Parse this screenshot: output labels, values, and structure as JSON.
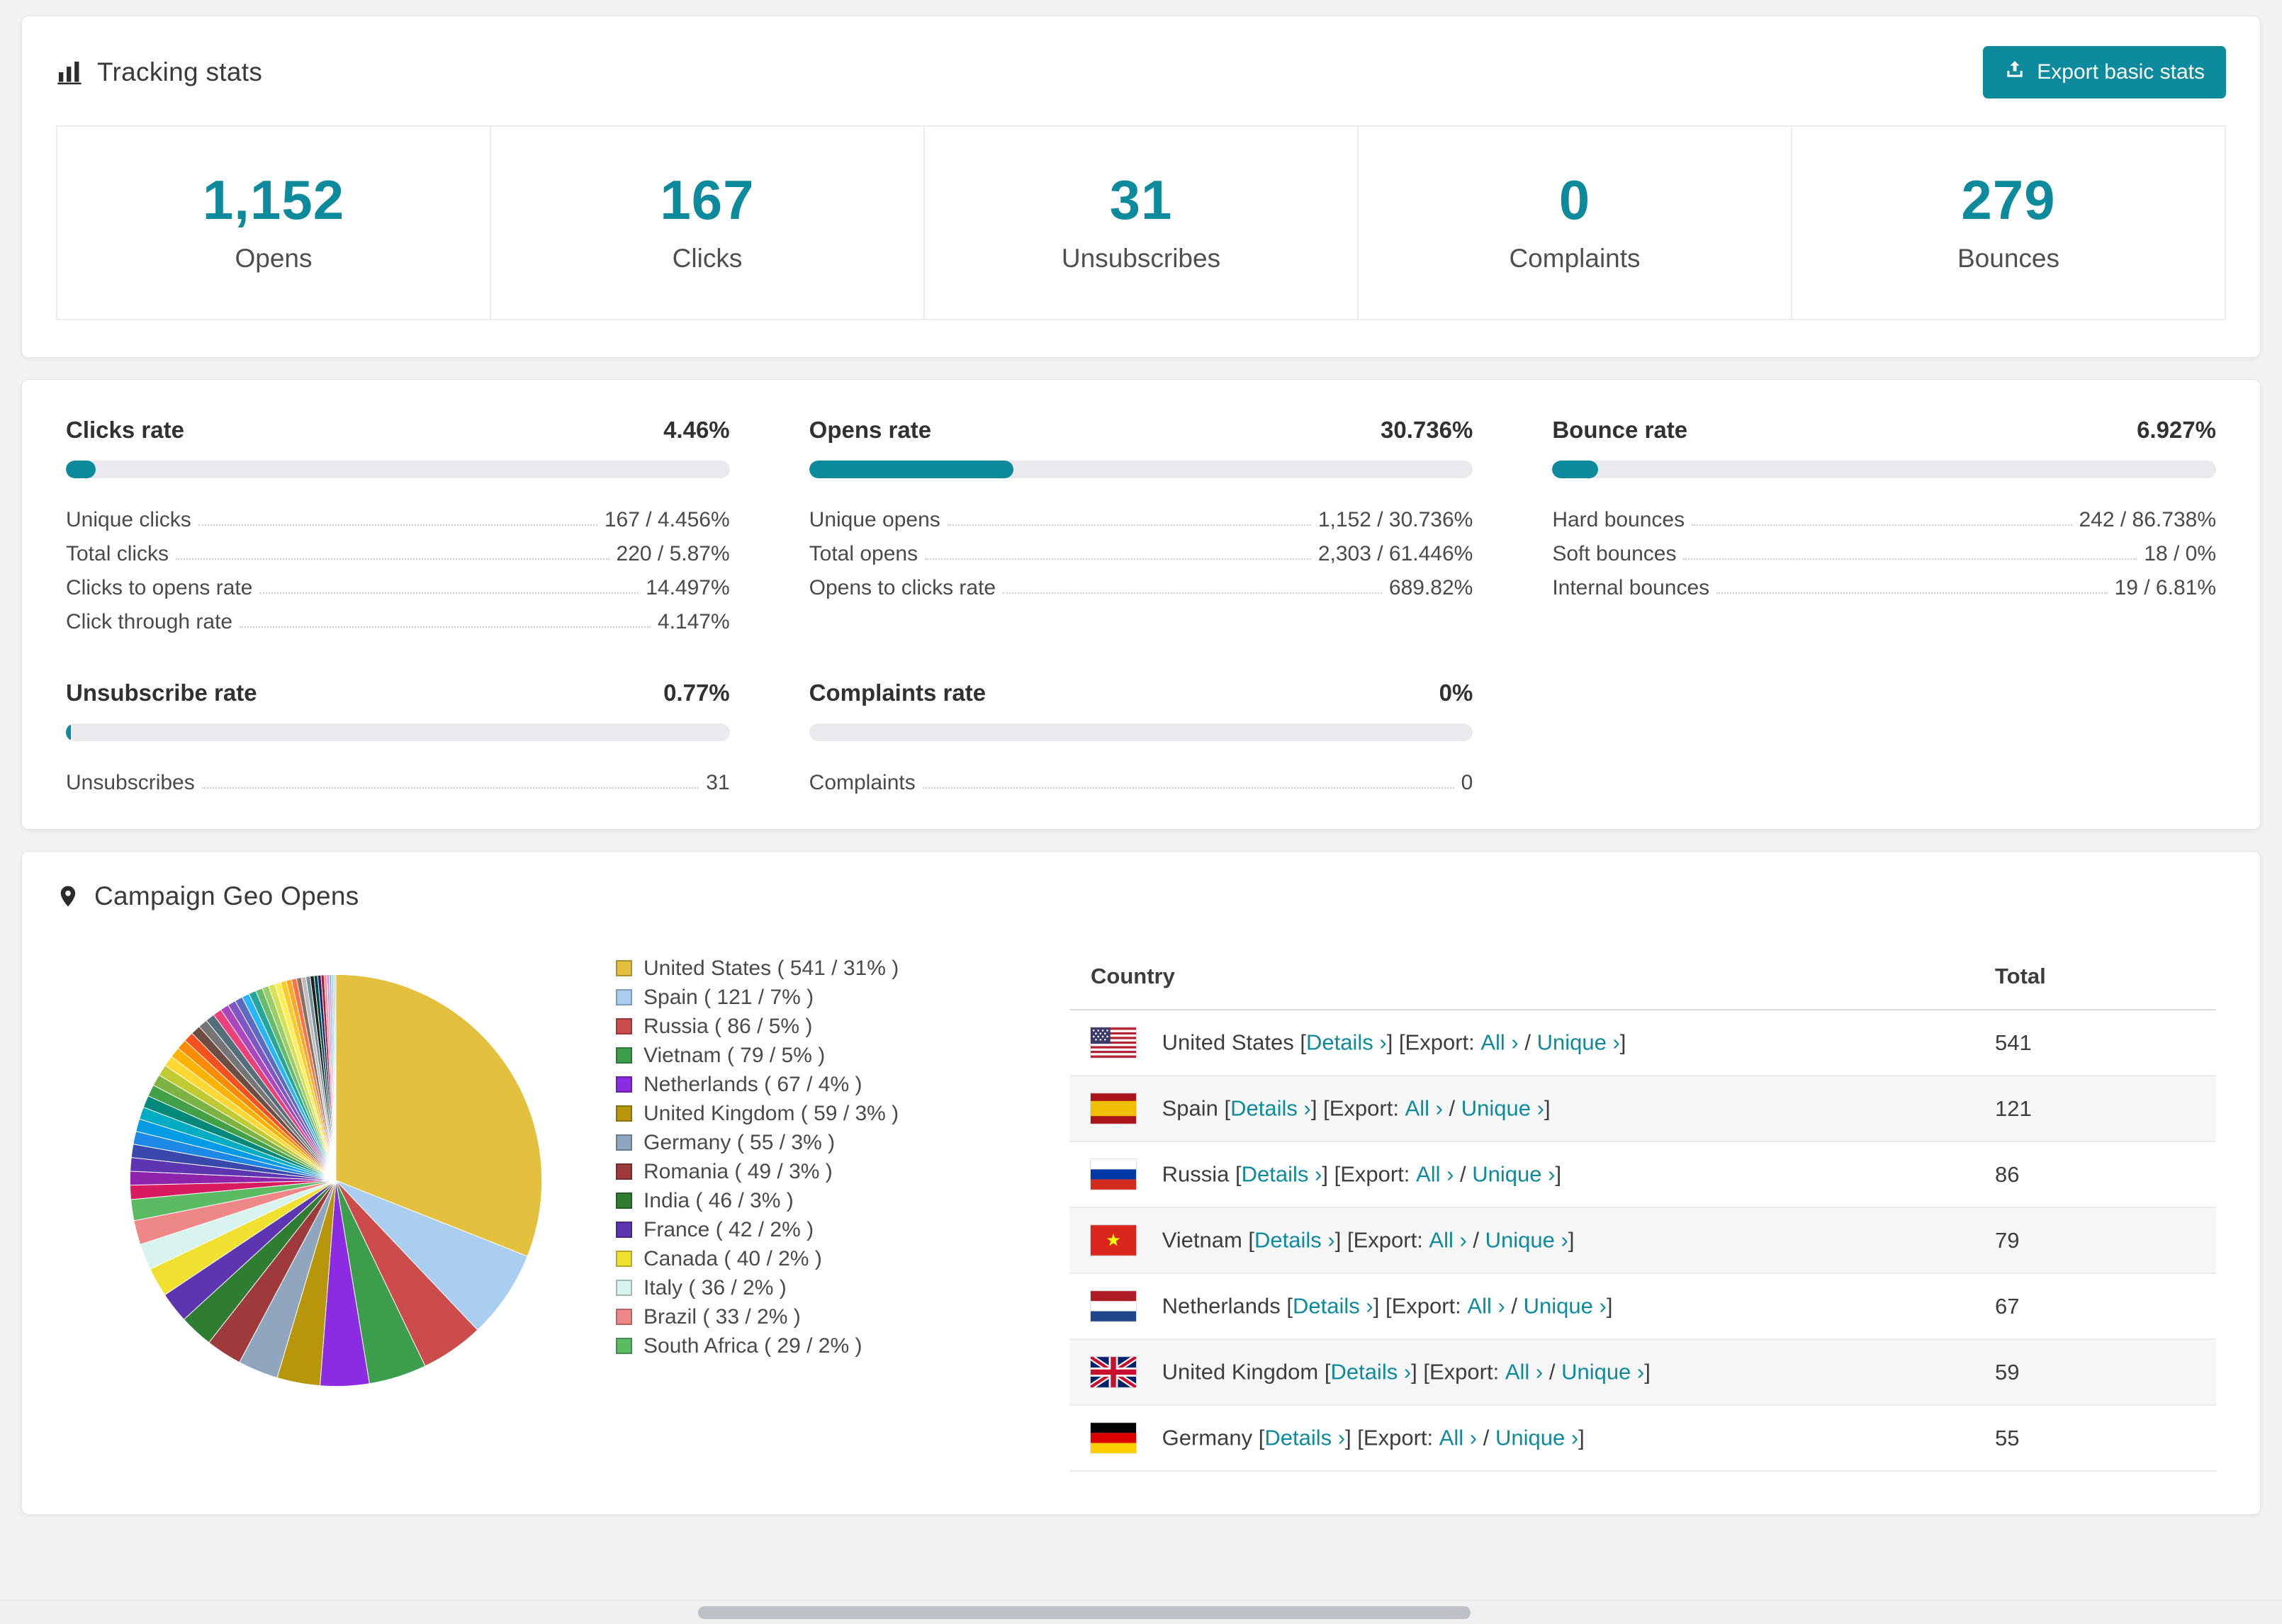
{
  "colors": {
    "accent": "#0E8A9D",
    "page_bg": "#F2F2F3",
    "link": "#0E8A9D"
  },
  "tracking": {
    "title": "Tracking stats",
    "export_button": "Export basic stats",
    "stats": [
      {
        "value": "1,152",
        "label": "Opens"
      },
      {
        "value": "167",
        "label": "Clicks"
      },
      {
        "value": "31",
        "label": "Unsubscribes"
      },
      {
        "value": "0",
        "label": "Complaints"
      },
      {
        "value": "279",
        "label": "Bounces"
      }
    ]
  },
  "rates": [
    {
      "title": "Clicks rate",
      "value": "4.46%",
      "percent": 4.46,
      "rows": [
        {
          "label": "Unique clicks",
          "value": "167 / 4.456%"
        },
        {
          "label": "Total clicks",
          "value": "220 / 5.87%"
        },
        {
          "label": "Clicks to opens rate",
          "value": "14.497%"
        },
        {
          "label": "Click through rate",
          "value": "4.147%"
        }
      ]
    },
    {
      "title": "Opens rate",
      "value": "30.736%",
      "percent": 30.736,
      "rows": [
        {
          "label": "Unique opens",
          "value": "1,152 / 30.736%"
        },
        {
          "label": "Total opens",
          "value": "2,303 / 61.446%"
        },
        {
          "label": "Opens to clicks rate",
          "value": "689.82%"
        }
      ]
    },
    {
      "title": "Bounce rate",
      "value": "6.927%",
      "percent": 6.927,
      "rows": [
        {
          "label": "Hard bounces",
          "value": "242 / 86.738%"
        },
        {
          "label": "Soft bounces",
          "value": "18 / 0%"
        },
        {
          "label": "Internal bounces",
          "value": "19 / 6.81%"
        }
      ]
    },
    {
      "title": "Unsubscribe rate",
      "value": "0.77%",
      "percent": 0.77,
      "rows": [
        {
          "label": "Unsubscribes",
          "value": "31"
        }
      ]
    },
    {
      "title": "Complaints rate",
      "value": "0%",
      "percent": 0,
      "rows": [
        {
          "label": "Complaints",
          "value": "0"
        }
      ]
    }
  ],
  "geo": {
    "title": "Campaign Geo Opens",
    "table_headers": {
      "country": "Country",
      "total": "Total"
    },
    "link_labels": {
      "details": "Details ›",
      "export": "Export:",
      "all": "All ›",
      "unique": "Unique ›"
    },
    "visible_table_rows": 7,
    "countries": [
      {
        "name": "United States",
        "flag": "us",
        "total": 541,
        "percent": 31,
        "color": "#E4C03F"
      },
      {
        "name": "Spain",
        "flag": "es",
        "total": 121,
        "percent": 7,
        "color": "#A9CEF0"
      },
      {
        "name": "Russia",
        "flag": "ru",
        "total": 86,
        "percent": 5,
        "color": "#CC4B4B"
      },
      {
        "name": "Vietnam",
        "flag": "vn",
        "total": 79,
        "percent": 5,
        "color": "#3C9E4D"
      },
      {
        "name": "Netherlands",
        "flag": "nl",
        "total": 67,
        "percent": 4,
        "color": "#8B2BE2"
      },
      {
        "name": "United Kingdom",
        "flag": "gb",
        "total": 59,
        "percent": 3,
        "color": "#B8960C"
      },
      {
        "name": "Germany",
        "flag": "de",
        "total": 55,
        "percent": 3,
        "color": "#8FA6BE"
      },
      {
        "name": "Romania",
        "flag": "ro",
        "total": 49,
        "percent": 3,
        "color": "#9E3A3C"
      },
      {
        "name": "India",
        "flag": "in",
        "total": 46,
        "percent": 3,
        "color": "#2F7D33"
      },
      {
        "name": "France",
        "flag": "fr",
        "total": 42,
        "percent": 2,
        "color": "#5D35B0"
      },
      {
        "name": "Canada",
        "flag": "ca",
        "total": 40,
        "percent": 2,
        "color": "#F0E130"
      },
      {
        "name": "Italy",
        "flag": "it",
        "total": 36,
        "percent": 2,
        "color": "#D8F3EE"
      },
      {
        "name": "Brazil",
        "flag": "br",
        "total": 33,
        "percent": 2,
        "color": "#EE8787"
      },
      {
        "name": "South Africa",
        "flag": "za",
        "total": 29,
        "percent": 2,
        "color": "#5BBB63"
      }
    ],
    "chart_data": {
      "type": "pie",
      "title": "Campaign Geo Opens",
      "labels": [
        "United States",
        "Spain",
        "Russia",
        "Vietnam",
        "Netherlands",
        "United Kingdom",
        "Germany",
        "Romania",
        "India",
        "France",
        "Canada",
        "Italy",
        "Brazil",
        "South Africa"
      ],
      "values": [
        541,
        121,
        86,
        79,
        67,
        59,
        55,
        49,
        46,
        42,
        40,
        36,
        33,
        29
      ],
      "colors": [
        "#E4C03F",
        "#A9CEF0",
        "#CC4B4B",
        "#3C9E4D",
        "#8B2BE2",
        "#B8960C",
        "#8FA6BE",
        "#9E3A3C",
        "#2F7D33",
        "#5D35B0",
        "#F0E130",
        "#D8F3EE",
        "#EE8787",
        "#5BBB63"
      ],
      "others_value": 462,
      "others_palette": [
        "#D81B60",
        "#8E24AA",
        "#5E35B1",
        "#3949AB",
        "#1E88E5",
        "#039BE5",
        "#00ACC1",
        "#00897B",
        "#43A047",
        "#7CB342",
        "#C0CA33",
        "#FDD835",
        "#FFB300",
        "#FB8C00",
        "#F4511E",
        "#6D4C41",
        "#757575",
        "#546E7A",
        "#EC407A",
        "#AB47BC",
        "#7E57C2",
        "#5C6BC0",
        "#29B6F6",
        "#26A69A",
        "#66BB6A",
        "#9CCC65",
        "#D4E157",
        "#FFEE58",
        "#FFCA28",
        "#FFA726",
        "#FF7043",
        "#8D6E63",
        "#BDBDBD",
        "#78909C",
        "#212121",
        "#004D40",
        "#1A237E",
        "#B71C1C",
        "#F48FB1",
        "#CE93D8",
        "#9FA8DA",
        "#81D4FA",
        "#80CBC4",
        "#A5D6A7"
      ],
      "start_angle_deg": -90,
      "direction": "clockwise",
      "legend_position": "right"
    }
  }
}
